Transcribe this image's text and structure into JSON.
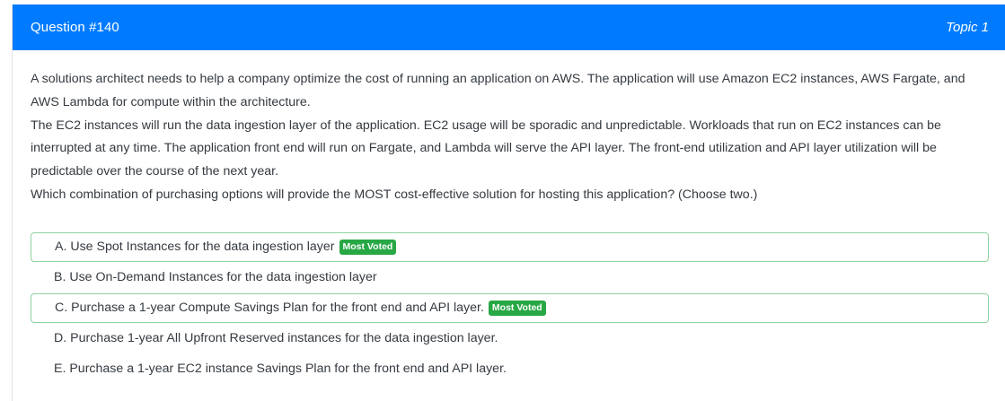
{
  "header": {
    "question_number": "Question #140",
    "topic": "Topic 1"
  },
  "question": {
    "paragraphs": [
      "A solutions architect needs to help a company optimize the cost of running an application on AWS. The application will use Amazon EC2 instances, AWS Fargate, and AWS Lambda for compute within the architecture.",
      "The EC2 instances will run the data ingestion layer of the application. EC2 usage will be sporadic and unpredictable. Workloads that run on EC2 instances can be interrupted at any time. The application front end will run on Fargate, and Lambda will serve the API layer. The front-end utilization and API layer utilization will be predictable over the course of the next year.",
      "Which combination of purchasing options will provide the MOST cost-effective solution for hosting this application? (Choose two.)"
    ]
  },
  "choices": [
    {
      "text": "A. Use Spot Instances for the data ingestion layer",
      "badge": "Most Voted"
    },
    {
      "text": "B. Use On-Demand Instances for the data ingestion layer"
    },
    {
      "text": "C. Purchase a 1-year Compute Savings Plan for the front end and API layer.",
      "badge": "Most Voted"
    },
    {
      "text": "D. Purchase 1-year All Upfront Reserved instances for the data ingestion layer."
    },
    {
      "text": "E. Purchase a 1-year EC2 instance Savings Plan for the front end and API layer."
    }
  ],
  "colors": {
    "header_bg": "#007bff",
    "badge_bg": "#28a745",
    "voted_border": "#8fd19e"
  }
}
